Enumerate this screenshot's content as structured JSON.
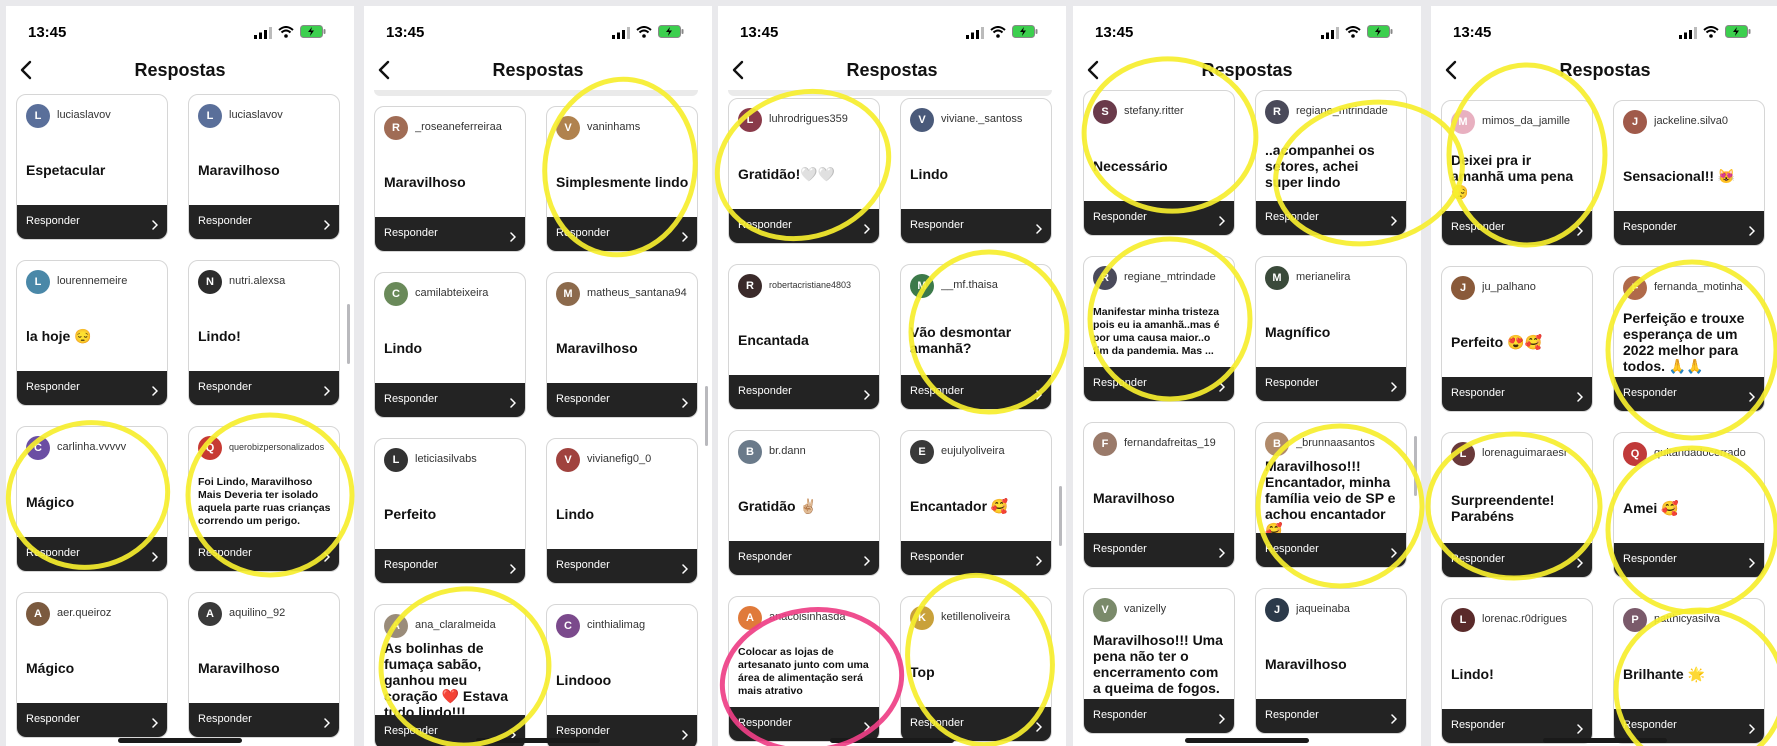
{
  "status_time": "13:45",
  "nav_title": "Respostas",
  "reply_label": "Responder",
  "colors": {
    "marker_yellow": "#f6ee2e",
    "marker_pink": "#ee3f86",
    "bar": "#232323"
  },
  "icons": [
    "signal-icon",
    "wifi-icon",
    "battery-charging-icon",
    "back-chevron-icon",
    "chevron-right-icon",
    "avatar"
  ],
  "screens": [
    {
      "cards": [
        {
          "user": "luciaslavov",
          "message": "Espetacular",
          "avatar_color": "#5a6f9a"
        },
        {
          "user": "luciaslavov",
          "message": "Maravilhoso",
          "avatar_color": "#5a6f9a"
        },
        {
          "user": "lourennemeire",
          "message": "la hoje 😔",
          "avatar_color": "#4a88a8"
        },
        {
          "user": "nutri.alexsa",
          "message": "Lindo!",
          "avatar_color": "#2c2c2c"
        },
        {
          "user": "carlinha.vvvvv",
          "message": "Mágico",
          "avatar_color": "#6b4ea3"
        },
        {
          "user": "querobizpersonalizados",
          "message": "Foi Lindo, Maravilhoso\nMais Deveria ter isolado aquela parte ruas crianças correndo um perigo.",
          "avatar_color": "#c73a33"
        },
        {
          "user": "aer.queiroz",
          "message": "Mágico",
          "avatar_color": "#7b5a3f"
        },
        {
          "user": "aquilino_92",
          "message": "Maravilhoso",
          "avatar_color": "#3a3a3a"
        }
      ]
    },
    {
      "cards": [
        {
          "user": "_roseaneferreiraa",
          "message": "Maravilhoso",
          "avatar_color": "#a06c55"
        },
        {
          "user": "vaninhams",
          "message": "Simplesmente lindo",
          "avatar_color": "#b0824e"
        },
        {
          "user": "camilabteixeira",
          "message": "Lindo",
          "avatar_color": "#6a8a5a"
        },
        {
          "user": "matheus_santana94",
          "message": "Maravilhoso",
          "avatar_color": "#8c6a4c"
        },
        {
          "user": "leticiasilvabs",
          "message": "Perfeito",
          "avatar_color": "#333333"
        },
        {
          "user": "vivianefig0_0",
          "message": "Lindo",
          "avatar_color": "#a0423e"
        },
        {
          "user": "ana_claralmeida",
          "message": "As bolinhas de fumaça sabão, ganhou meu coração ❤️  Estava tudo lindo!!!",
          "avatar_color": "#9a8c7a"
        },
        {
          "user": "cinthialimag",
          "message": "Lindooo",
          "avatar_color": "#7b4a8c"
        }
      ]
    },
    {
      "cards": [
        {
          "user": "luhrodrigues359",
          "message": "Gratidão!🤍🤍",
          "avatar_color": "#8a3a4a"
        },
        {
          "user": "viviane._santoss",
          "message": "Lindo",
          "avatar_color": "#4a5a7a"
        },
        {
          "user": "robertacristiane4803",
          "message": "Encantada",
          "avatar_color": "#3a2a2a"
        },
        {
          "user": "__mf.thaisa",
          "message": "Vão desmontar amanhã?",
          "avatar_color": "#3c7a4a"
        },
        {
          "user": "br.dann",
          "message": "Gratidão ✌🏼",
          "avatar_color": "#6a7a8a"
        },
        {
          "user": "eujulyoliveira",
          "message": "Encantador 🥰",
          "avatar_color": "#3a3a3a"
        },
        {
          "user": "anacoisinhasda",
          "message": "Colocar as lojas de artesanato junto com uma área de alimentação será mais atrativo",
          "avatar_color": "#e07a3a"
        },
        {
          "user": "ketillenoliveira",
          "message": "Top",
          "avatar_color": "#c9a13a"
        }
      ]
    },
    {
      "cards": [
        {
          "user": "stefany.ritter",
          "message": "Necessário",
          "avatar_color": "#6a3a4a"
        },
        {
          "user": "regiane_mtrindade",
          "message": "..acompanhei os setores, achei super lindo",
          "avatar_color": "#4a4a5a"
        },
        {
          "user": "regiane_mtrindade",
          "message": "Manifestar minha tristeza pois eu ia amanhã..mas é por uma causa maior..o fim da pandemia. Mas ...",
          "avatar_color": "#4a4a5a"
        },
        {
          "user": "merianelira",
          "message": "Magnífico",
          "avatar_color": "#3a4a3a"
        },
        {
          "user": "fernandafreitas_19",
          "message": "Maravilhoso",
          "avatar_color": "#9a7a6a"
        },
        {
          "user": "_brunnaasantos",
          "message": "Maravilhoso!!! Encantador, minha família veio de SP e achou encantador 🥰",
          "avatar_color": "#b08a6a"
        },
        {
          "user": "vanizelly",
          "message": "Maravilhoso!!! Uma pena não ter o encerramento com a queima de fogos.",
          "avatar_color": "#7a8a6a"
        },
        {
          "user": "jaqueinaba",
          "message": "Maravilhoso",
          "avatar_color": "#2c3a4a"
        }
      ]
    },
    {
      "cards": [
        {
          "user": "mimos_da_jamille",
          "message": "Deixei pra ir amanhã  uma pena 😔",
          "avatar_color": "#e8b0c0"
        },
        {
          "user": "jackeline.silva0",
          "message": "Sensacional!! 😻",
          "avatar_color": "#a05a4a"
        },
        {
          "user": "ju_palhano",
          "message": "Perfeito 😍🥰",
          "avatar_color": "#8a5a3a"
        },
        {
          "user": "fernanda_motinha",
          "message": "Perfeição e trouxe esperança de um 2022 melhor para todos. 🙏🙏",
          "avatar_color": "#b06a4a"
        },
        {
          "user": "lorenaguimaraesr",
          "message": "Surpreendente! Parabéns",
          "avatar_color": "#6a3a3a"
        },
        {
          "user": "quitandadocerrado",
          "message": "Amei 🥰",
          "avatar_color": "#c03a3a"
        },
        {
          "user": "lorenac.r0drigues",
          "message": "Lindo!",
          "avatar_color": "#5a2a2a"
        },
        {
          "user": "patthicyasilva",
          "message": "Brilhante 🌟",
          "avatar_color": "#7a5a6a"
        }
      ]
    }
  ]
}
